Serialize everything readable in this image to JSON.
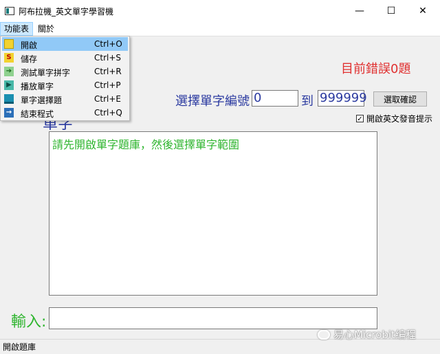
{
  "window": {
    "title": "阿布拉機_英文單字學習機",
    "minimize": "—",
    "maximize": "☐",
    "close": "✕"
  },
  "menubar": {
    "items": [
      "功能表",
      "關於"
    ]
  },
  "dropdown": {
    "items": [
      {
        "label": "開啟",
        "shortcut": "Ctrl+O",
        "icon": "open-icon"
      },
      {
        "label": "儲存",
        "shortcut": "Ctrl+S",
        "icon": "save-icon"
      },
      {
        "label": "測試單字拼字",
        "shortcut": "Ctrl+R",
        "icon": "spelling-test-icon"
      },
      {
        "label": "播放單字",
        "shortcut": "Ctrl+P",
        "icon": "play-icon"
      },
      {
        "label": "單字選擇題",
        "shortcut": "Ctrl+E",
        "icon": "quiz-icon"
      },
      {
        "label": "結束程式",
        "shortcut": "Ctrl+Q",
        "icon": "exit-icon"
      }
    ]
  },
  "main": {
    "error_count": "目前錯誤0題",
    "range_label": "選擇單字編號",
    "range_start": "0",
    "to_label": "到",
    "range_end": "999999",
    "confirm_button": "選取確認",
    "pronunciation_checkbox": {
      "label": "開啟英文發音提示",
      "checked": true
    },
    "word_label": "單字",
    "word_area_text": "請先開啟單字題庫，然後選擇單字範圍",
    "input_label": "輸入:",
    "input_value": ""
  },
  "statusbar": {
    "text": "開啟題庫"
  },
  "watermark": "易心Microbit编程",
  "colors": {
    "error": "#e03030",
    "label_blue": "#2b3aa0",
    "hint_green": "#2fb52f",
    "menu_highlight": "#91c9f7"
  }
}
